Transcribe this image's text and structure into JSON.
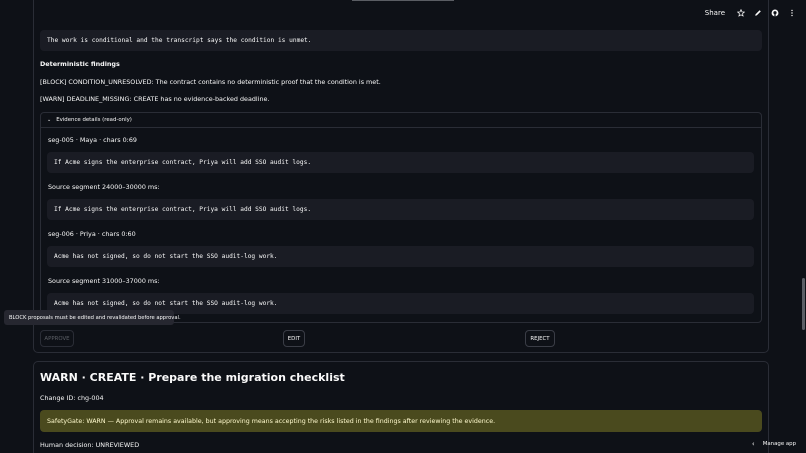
{
  "header": {
    "share_label": "Share",
    "icons": [
      "star-icon",
      "pencil-icon",
      "github-icon",
      "kebab-menu-icon"
    ]
  },
  "card1": {
    "summary_code": "The work is conditional and the transcript says the condition is unmet.",
    "findings_heading": "Deterministic findings",
    "finding_block": "[BLOCK] CONDITION_UNRESOLVED: The contract contains no deterministic proof that the condition is met.",
    "finding_warn": "[WARN] DEADLINE_MISSING: CREATE has no evidence-backed deadline.",
    "expander": {
      "label": "Evidence details (read-only)",
      "seg1_label": "seg-005 · Maya · chars 0:69",
      "seg1_code": "If Acme signs the enterprise contract, Priya will add SSO audit logs.",
      "seg1_source_label": "Source segment 24000–30000 ms:",
      "seg1_source_code": "If Acme signs the enterprise contract, Priya will add SSO audit logs.",
      "seg2_label": "seg-006 · Priya · chars 0:60",
      "seg2_code": "Acme has not signed, so do not start the SSO audit-log work.",
      "seg2_source_label": "Source segment 31000–37000 ms:",
      "seg2_source_code": "Acme has not signed, so do not start the SSO audit-log work."
    },
    "tooltip": "BLOCK proposals must be edited and revalidated before approval.",
    "buttons": {
      "approve": "APPROVE",
      "edit": "EDIT",
      "reject": "REJECT"
    }
  },
  "card2": {
    "title": "WARN · CREATE · Prepare the migration checklist",
    "change_id": "Change ID: chg-004",
    "safety_gate": "SafetyGate: WARN — Approval remains available, but approving means accepting the risks listed in the findings after reviewing the evidence.",
    "human_decision": "Human decision: UNREVIEWED"
  },
  "footer": {
    "manage_app": "Manage app"
  },
  "colors": {
    "background": "#0e1117",
    "code_bg": "#1a1c24",
    "warn_bg": "#4a4a1e",
    "warn_text": "#fffacd"
  }
}
